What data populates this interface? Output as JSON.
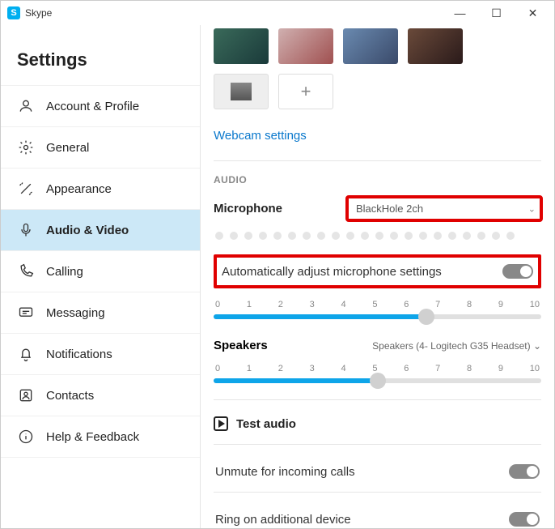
{
  "titlebar": {
    "app_name": "Skype"
  },
  "sidebar": {
    "heading": "Settings",
    "items": [
      {
        "label": "Account & Profile"
      },
      {
        "label": "General"
      },
      {
        "label": "Appearance"
      },
      {
        "label": "Audio & Video"
      },
      {
        "label": "Calling"
      },
      {
        "label": "Messaging"
      },
      {
        "label": "Notifications"
      },
      {
        "label": "Contacts"
      },
      {
        "label": "Help & Feedback"
      }
    ]
  },
  "content": {
    "webcam_link": "Webcam settings",
    "audio_section": "AUDIO",
    "microphone_label": "Microphone",
    "microphone_value": "BlackHole 2ch",
    "auto_adjust_label": "Automatically adjust microphone settings",
    "mic_slider": {
      "value": 6.5,
      "scale": [
        "0",
        "1",
        "2",
        "3",
        "4",
        "5",
        "6",
        "7",
        "8",
        "9",
        "10"
      ]
    },
    "speakers_label": "Speakers",
    "speakers_value": "Speakers (4- Logitech G35 Headset)",
    "spk_slider": {
      "value": 5.0,
      "scale": [
        "0",
        "1",
        "2",
        "3",
        "4",
        "5",
        "6",
        "7",
        "8",
        "9",
        "10"
      ]
    },
    "test_audio": "Test audio",
    "unmute_label": "Unmute for incoming calls",
    "ring_label": "Ring on additional device"
  }
}
